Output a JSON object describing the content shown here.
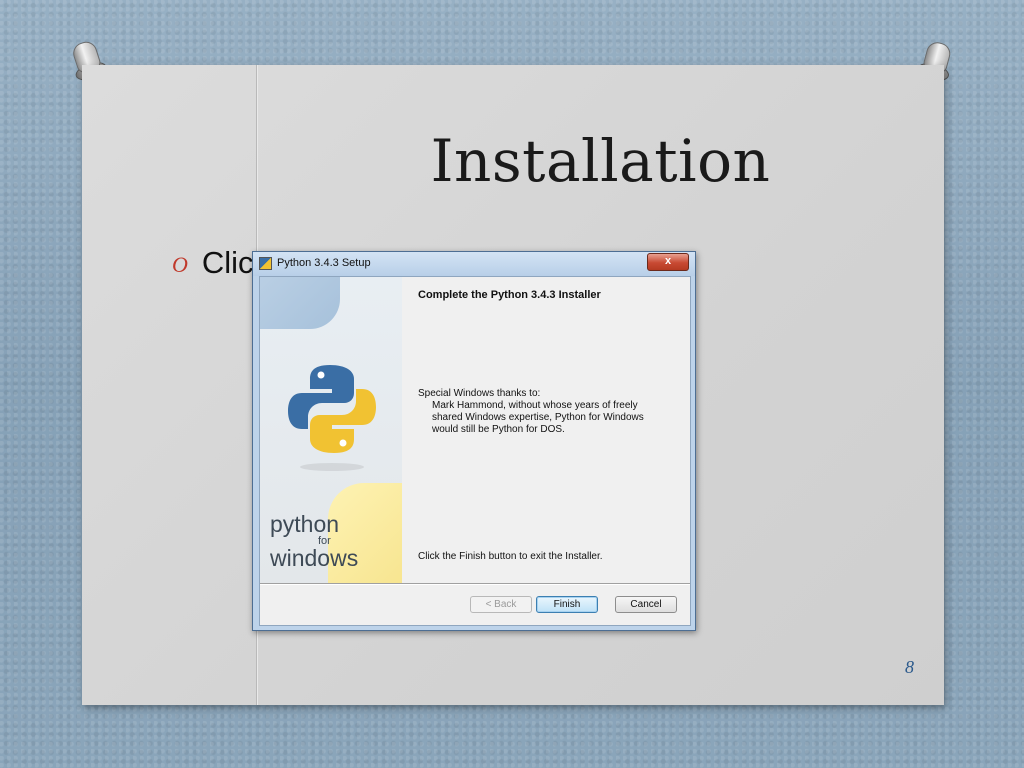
{
  "slide": {
    "title": "Installation",
    "bullet_glyph": "O",
    "bullet": "Click Finish",
    "page_number": "8"
  },
  "dialog": {
    "title": "Python 3.4.3 Setup",
    "close_label": "x",
    "heading": "Complete the Python 3.4.3 Installer",
    "thanks_intro": "Special Windows thanks to:",
    "thanks_line1": "Mark Hammond, without whose years of freely",
    "thanks_line2": "shared Windows expertise, Python for Windows",
    "thanks_line3": "would still be Python for DOS.",
    "exit_note": "Click the Finish button to exit the Installer.",
    "brand_python": "python",
    "brand_for": "for",
    "brand_windows": "windows",
    "buttons": {
      "back": "< Back",
      "finish": "Finish",
      "cancel": "Cancel"
    }
  },
  "colors": {
    "python_blue": "#3a6ea5",
    "python_yellow": "#f1c232",
    "bullet_accent": "#c0392b",
    "page_number": "#2c5a8c"
  }
}
